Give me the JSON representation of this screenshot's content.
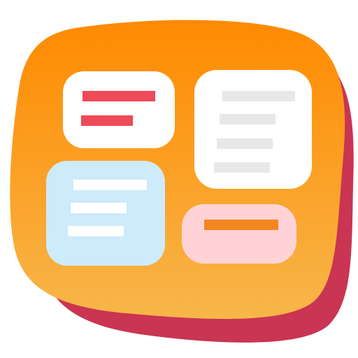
{
  "icon": {
    "name": "kanban-notes-app-icon",
    "colors": {
      "background": "#ffffff",
      "shadow": "#c93552",
      "gradient_top": "#ff8a00",
      "gradient_bottom": "#f7b64a",
      "card_white": "#ffffff",
      "card_blue": "#cdebfb",
      "card_pink": "#ffd3d6",
      "line_red": "#ef4a57",
      "line_gray": "#e8e8e8",
      "line_white": "#ffffff",
      "line_orange": "#f4861f"
    },
    "cards": [
      {
        "name": "top-left-card",
        "color": "card_white",
        "lines": 2,
        "line_color": "line_red"
      },
      {
        "name": "top-right-card",
        "color": "card_white",
        "lines": 4,
        "line_color": "line_gray"
      },
      {
        "name": "bottom-left-card",
        "color": "card_blue",
        "lines": 3,
        "line_color": "line_white"
      },
      {
        "name": "bottom-right-card",
        "color": "card_pink",
        "lines": 1,
        "line_color": "line_orange"
      }
    ]
  }
}
